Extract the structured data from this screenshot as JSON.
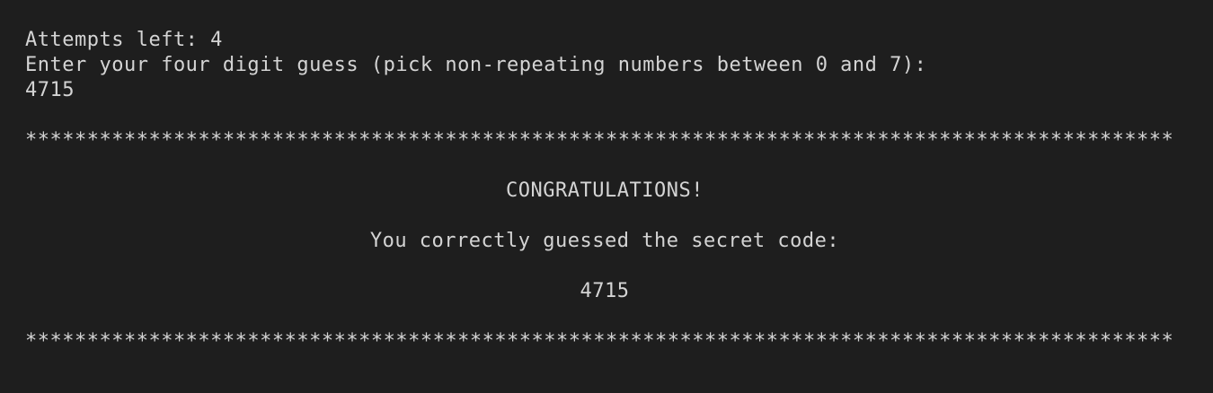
{
  "terminal": {
    "attempts_line": "Attempts left: 4",
    "prompt_line": "Enter your four digit guess (pick non-repeating numbers between 0 and 7):",
    "user_input": "4715",
    "separator_top": "*********************************************************************************************",
    "congrats": "CONGRATULATIONS!",
    "message": "You correctly guessed the secret code:",
    "secret_code": "4715",
    "separator_bottom": "*********************************************************************************************"
  },
  "colors": {
    "background": "#1e1e1e",
    "text": "#d4d4d4"
  }
}
